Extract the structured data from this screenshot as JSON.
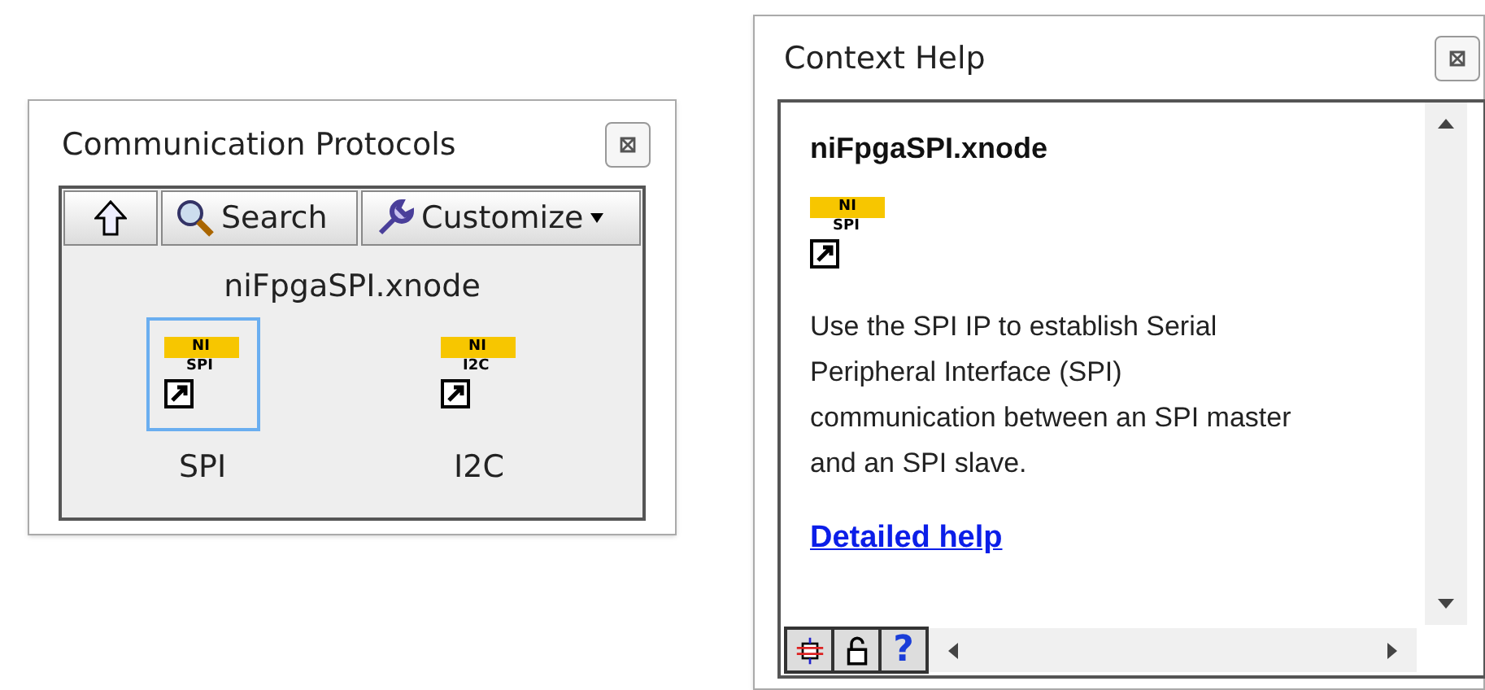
{
  "palette": {
    "title": "Communication Protocols",
    "toolbar": [
      {
        "kind": "up"
      },
      {
        "kind": "search",
        "label": "Search"
      },
      {
        "kind": "customize",
        "label": "Customize"
      }
    ],
    "category": "niFpgaSPI.xnode",
    "items": [
      {
        "label": "SPI",
        "icon_top": "NI",
        "icon_sub": "SPI",
        "selected": true
      },
      {
        "label": "I2C",
        "icon_top": "NI",
        "icon_sub": "I2C",
        "selected": false
      }
    ]
  },
  "context_help": {
    "title": "Context Help",
    "heading": "niFpgaSPI.xnode",
    "icon_top": "NI",
    "icon_sub": "SPI",
    "description": "Use the SPI IP to establish Serial Peripheral Interface (SPI) communication between an SPI master and an SPI slave.",
    "link": "Detailed help",
    "buttons": [
      {
        "kind": "diagram"
      },
      {
        "kind": "lock"
      },
      {
        "kind": "help",
        "label": "?"
      }
    ]
  }
}
